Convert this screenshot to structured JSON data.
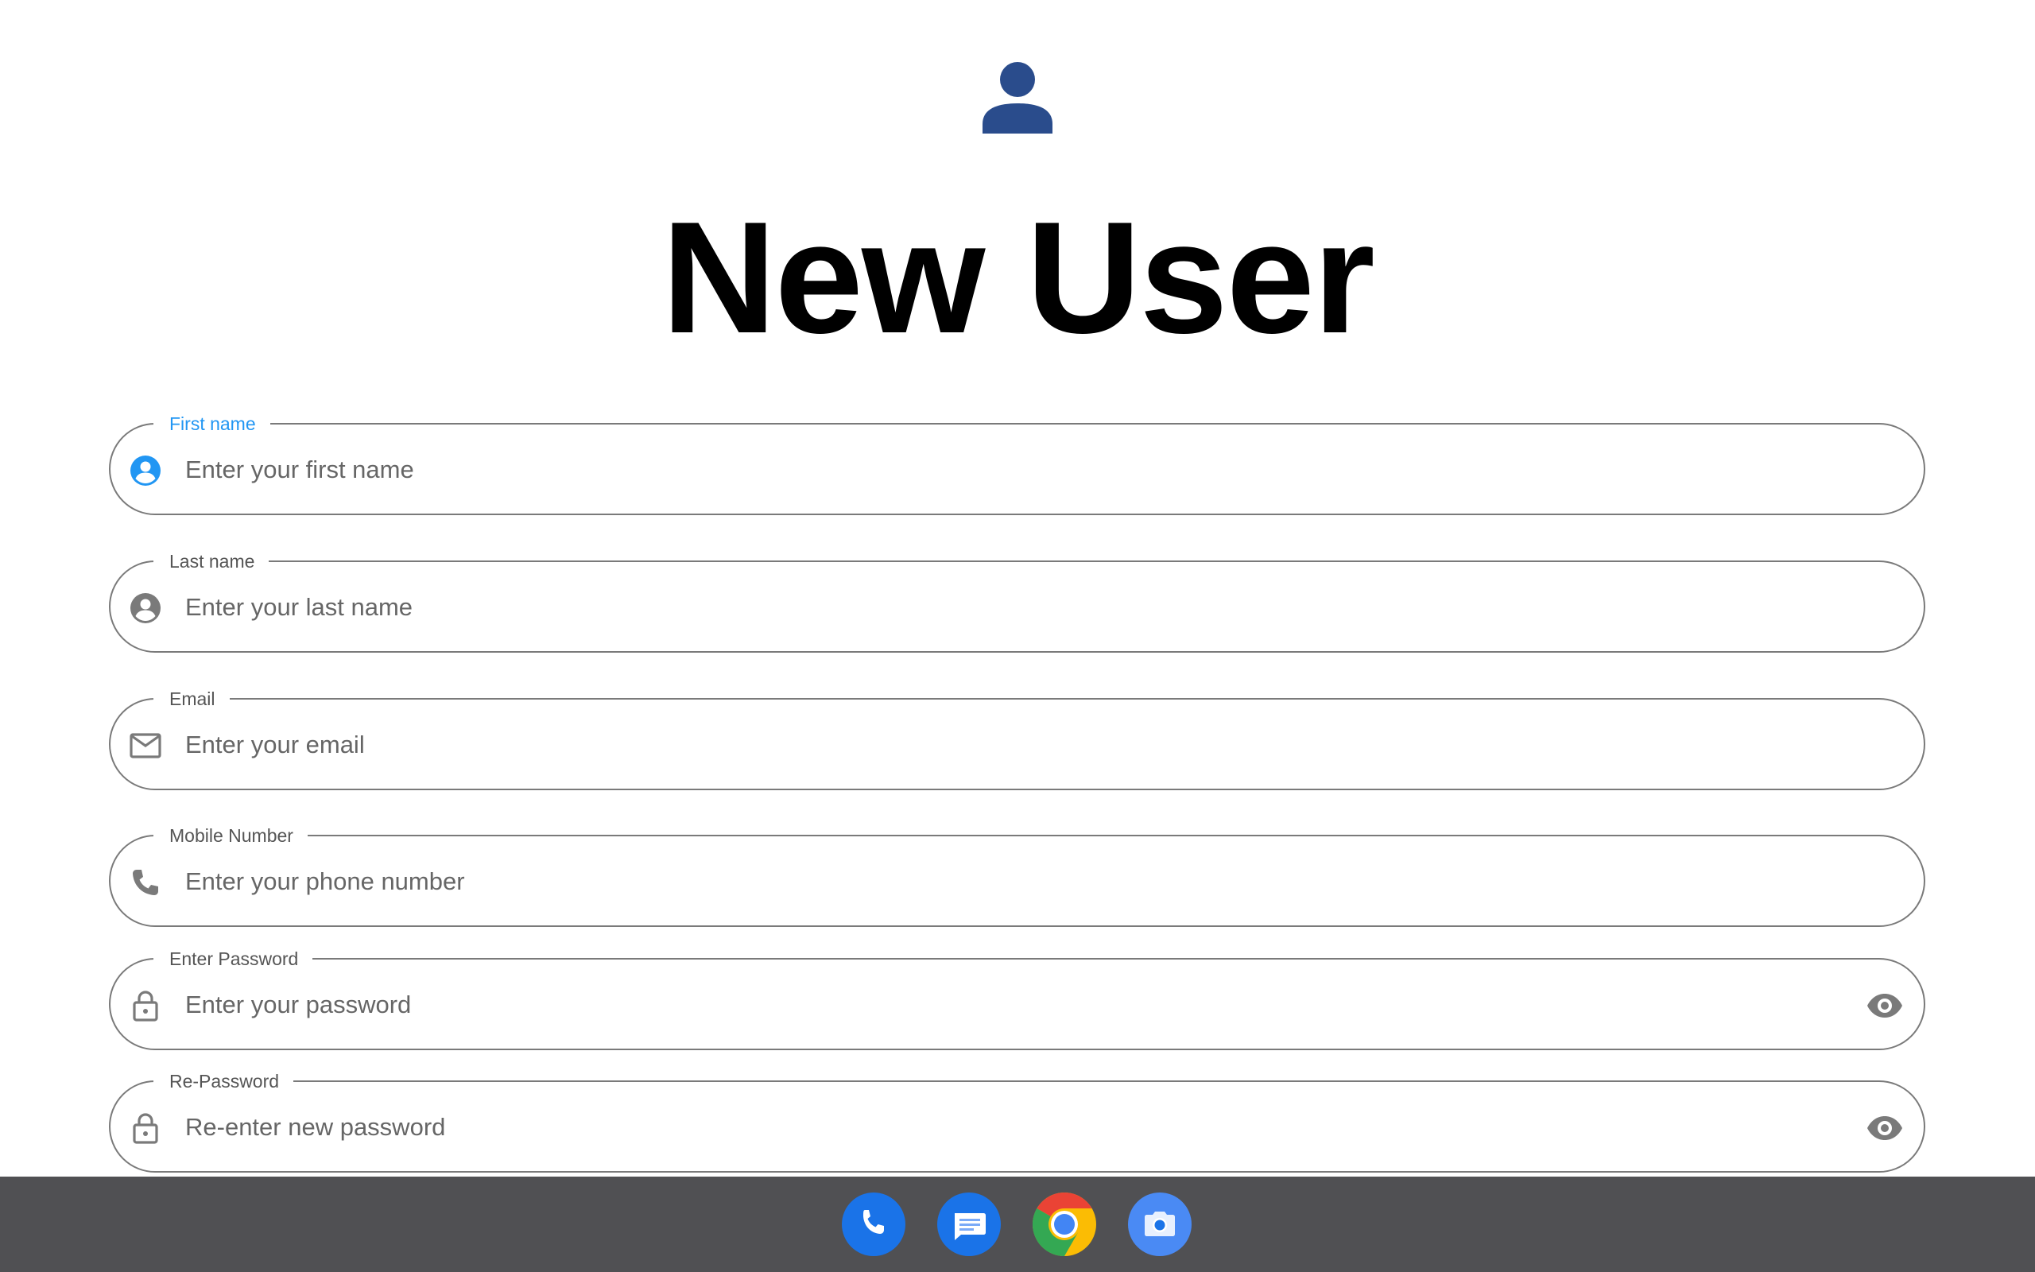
{
  "header": {
    "avatar_icon": "person-icon",
    "title": "New User"
  },
  "form": {
    "fields": [
      {
        "label": "First name",
        "placeholder": "Enter your first name",
        "icon": "account-circle-icon",
        "focused": true
      },
      {
        "label": "Last name",
        "placeholder": "Enter your last name",
        "icon": "account-circle-icon",
        "focused": false
      },
      {
        "label": "Email",
        "placeholder": "Enter your email",
        "icon": "mail-icon",
        "focused": false
      },
      {
        "label": "Mobile Number",
        "placeholder": "Enter your phone number",
        "icon": "phone-icon",
        "focused": false
      },
      {
        "label": "Enter Password",
        "placeholder": "Enter your password",
        "icon": "lock-icon",
        "trailing_icon": "eye-icon",
        "focused": false
      },
      {
        "label": "Re-Password",
        "placeholder": "Re-enter new password",
        "icon": "lock-icon",
        "trailing_icon": "eye-icon",
        "focused": false
      }
    ]
  },
  "taskbar": {
    "apps": [
      "phone-app-icon",
      "messages-app-icon",
      "chrome-app-icon",
      "camera-app-icon"
    ]
  },
  "colors": {
    "accent": "#2196f3",
    "avatar": "#2a4c8c",
    "border": "#7a7a7a",
    "icon_gray": "#7a7a7a",
    "taskbar": "#505053"
  }
}
